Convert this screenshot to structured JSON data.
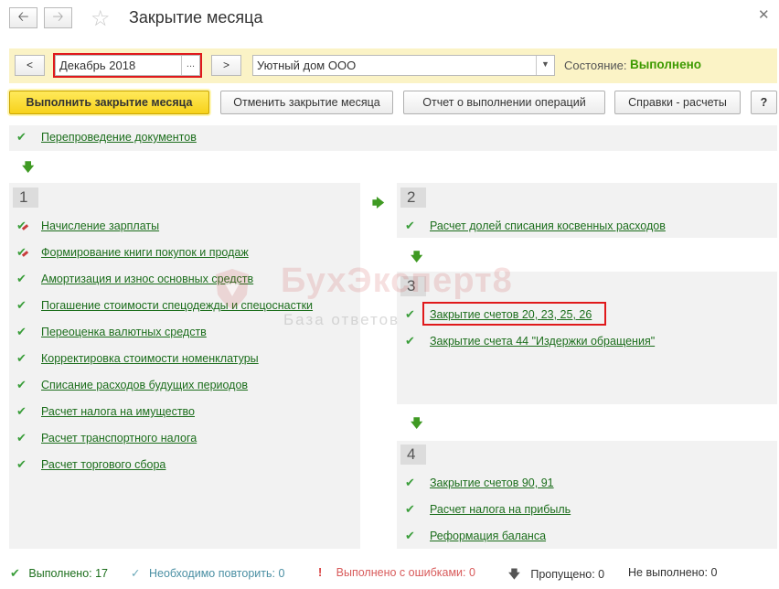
{
  "window": {
    "title": "Закрытие месяца"
  },
  "period": {
    "prev_label": "<",
    "next_label": ">",
    "month_value": "Декабрь 2018",
    "month_picker": "...",
    "org_value": "Уютный дом ООО",
    "state_label": "Состояние:",
    "state_value": "Выполнено"
  },
  "toolbar": {
    "run_label": "Выполнить закрытие месяца",
    "cancel_label": "Отменить закрытие месяца",
    "report_label": "Отчет о выполнении операций",
    "calc_label": "Справки - расчеты",
    "help_label": "?"
  },
  "top_item": "Перепроведение документов",
  "steps": [
    {
      "num": "1",
      "items": [
        "Начисление зарплаты",
        "Формирование книги покупок и продаж",
        "Амортизация и износ основных средств",
        "Погашение стоимости спецодежды и спецоснастки",
        "Переоценка валютных средств",
        "Корректировка стоимости номенклатуры",
        "Списание расходов будущих периодов",
        "Расчет налога на имущество",
        "Расчет транспортного налога",
        "Расчет торгового сбора"
      ]
    },
    {
      "num": "2",
      "items": [
        "Расчет долей списания косвенных расходов"
      ]
    },
    {
      "num": "3",
      "items": [
        "Закрытие счетов 20, 23, 25, 26",
        "Закрытие счета 44 \"Издержки обращения\""
      ]
    },
    {
      "num": "4",
      "items": [
        "Закрытие счетов 90, 91",
        "Расчет налога на прибыль",
        "Реформация баланса"
      ]
    }
  ],
  "watermark": {
    "title": "БухЭксперт8",
    "subtitle": "База ответов"
  },
  "status": {
    "done": "Выполнено: 17",
    "repeat": "Необходимо повторить: 0",
    "errors": "Выполнено с ошибками: 0",
    "skipped": "Пропущено: 0",
    "not_done": "Не выполнено: 0"
  },
  "colors": {
    "accent_yellow": "#f7d21b",
    "period_panel_bg": "#fbf3c6",
    "link_green": "#1c6e1c",
    "check_green": "#3b9e3b",
    "highlight_red": "#e0191b",
    "state_done": "#3c9a00"
  },
  "icons": {
    "check": "check-icon",
    "check_with_mark": "check-marked-icon",
    "arrow_down": "arrow-down-icon",
    "arrow_right": "arrow-right-icon"
  }
}
